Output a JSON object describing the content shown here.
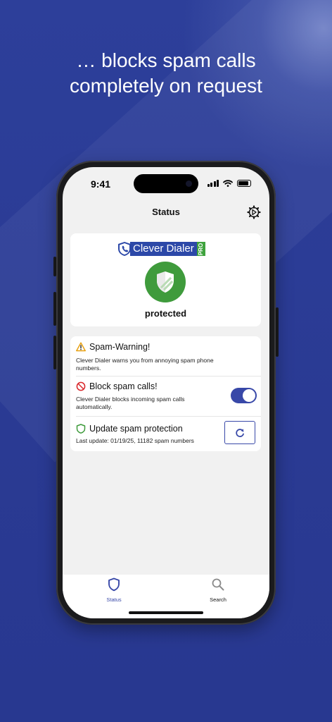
{
  "headline": {
    "line1": "… blocks spam calls",
    "line2": "completely on request"
  },
  "statusbar": {
    "time": "9:41"
  },
  "nav": {
    "title": "Status",
    "settings_icon": "gear-icon"
  },
  "logo": {
    "brand": "Clever Dialer",
    "badge": "PRO",
    "brand_color": "#2c48a8",
    "badge_color": "#3fa33e"
  },
  "protection": {
    "status_label": "protected",
    "icon": "shield-check-icon",
    "color": "#3f9b3c"
  },
  "features": [
    {
      "title": "Spam-Warning!",
      "description": "Clever Dialer warns you from annoying spam phone numbers.",
      "icon": "warning-icon"
    },
    {
      "title": "Block spam calls!",
      "description": "Clever Dialer blocks incoming spam calls automatically.",
      "icon": "block-icon",
      "toggle_on": true
    },
    {
      "title": "Update spam protection",
      "description": "Last update: 01/19/25, 11182 spam numbers",
      "icon": "shield-icon",
      "action_icon": "refresh-icon"
    }
  ],
  "tabs": [
    {
      "label": "Status",
      "icon": "shield-icon",
      "active": true
    },
    {
      "label": "Search",
      "icon": "search-icon",
      "active": false
    }
  ],
  "colors": {
    "accent": "#3848a8",
    "background": "#2a3a92"
  }
}
